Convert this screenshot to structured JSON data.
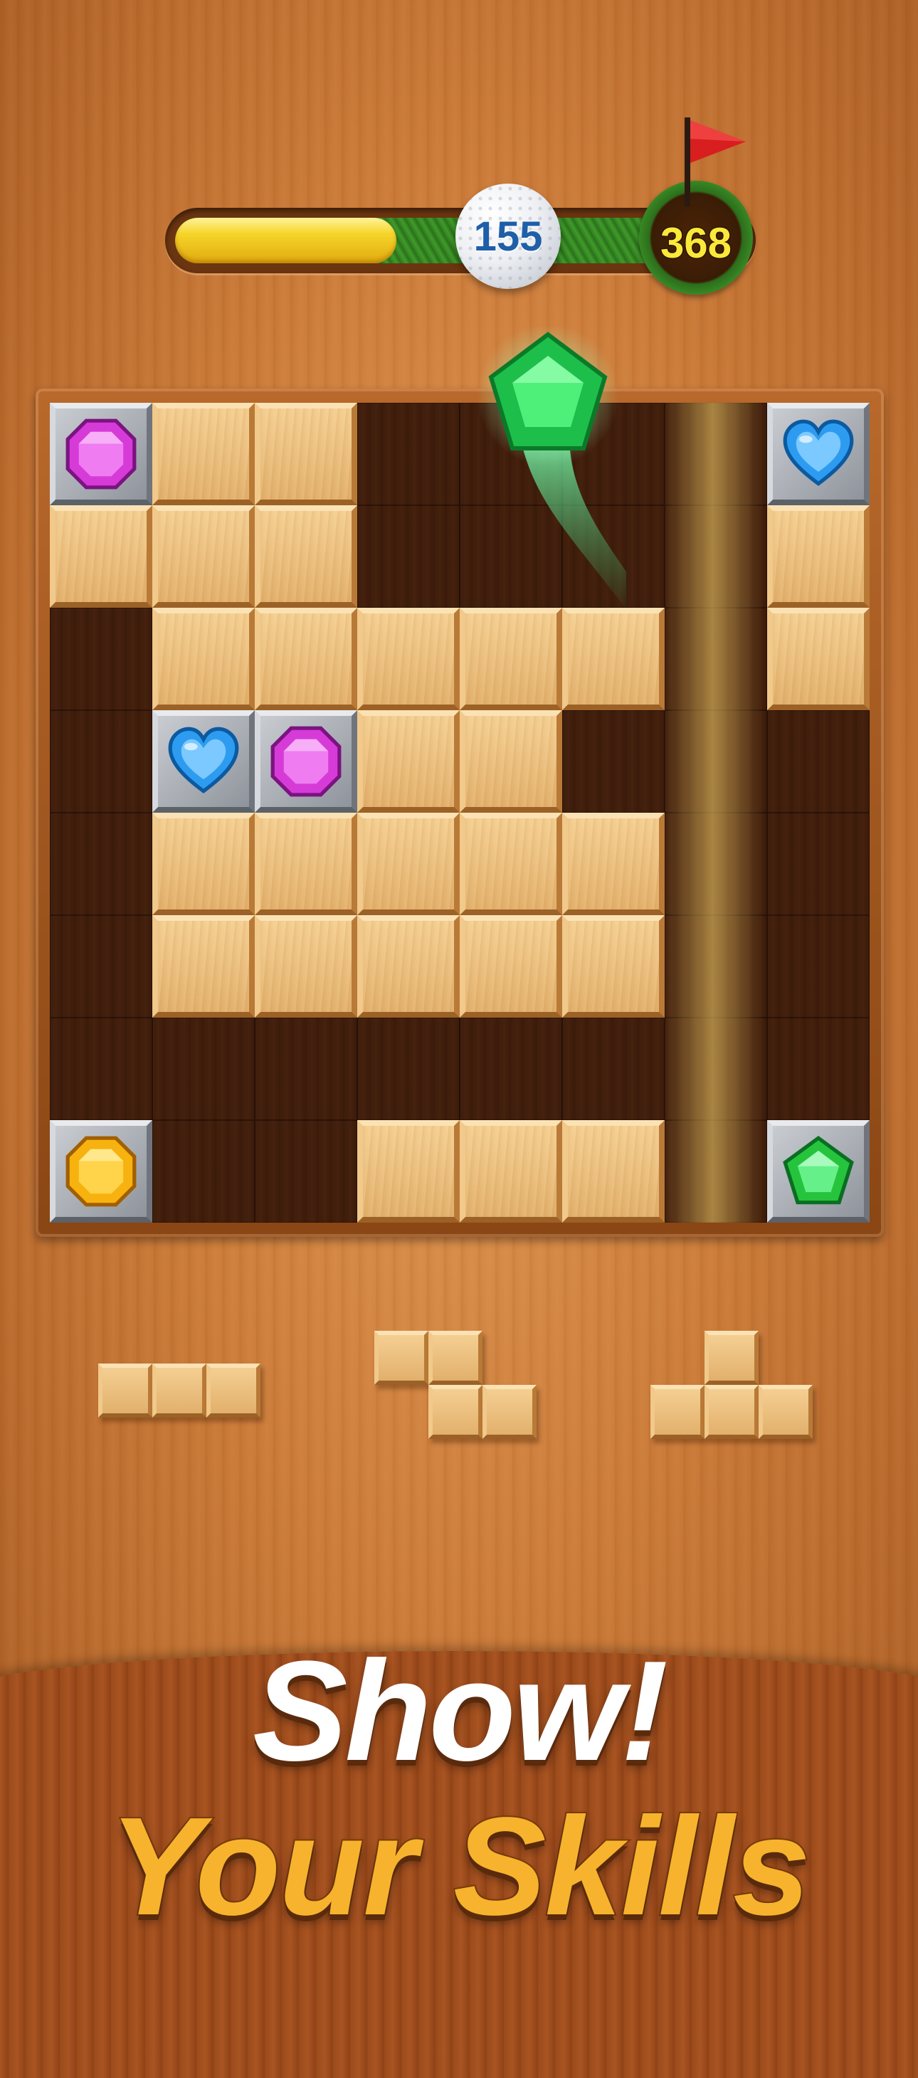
{
  "progress": {
    "current_score": "155",
    "target_score": "368",
    "fill_fraction": 0.44
  },
  "board": {
    "size": 8,
    "rows": [
      [
        "gem:purple-octagon",
        "wood",
        "wood",
        "empty",
        "empty",
        "empty",
        "empty",
        "gem:blue-heart"
      ],
      [
        "wood",
        "wood",
        "wood",
        "empty",
        "empty",
        "empty",
        "empty",
        "wood"
      ],
      [
        "empty",
        "wood",
        "wood",
        "wood",
        "wood",
        "wood",
        "empty",
        "wood"
      ],
      [
        "empty",
        "gem:blue-heart",
        "gem:purple-octagon",
        "wood",
        "wood",
        "empty",
        "empty",
        "empty"
      ],
      [
        "empty",
        "wood",
        "wood",
        "wood",
        "wood",
        "wood",
        "empty",
        "empty"
      ],
      [
        "empty",
        "wood",
        "wood",
        "wood",
        "wood",
        "wood",
        "empty",
        "empty"
      ],
      [
        "empty",
        "empty",
        "empty",
        "empty",
        "empty",
        "empty",
        "empty",
        "empty"
      ],
      [
        "gem:yellow-octagon",
        "empty",
        "empty",
        "wood",
        "wood",
        "wood",
        "empty",
        "gem:green-pentagon"
      ]
    ],
    "flying_gem": "green-pentagon-icon"
  },
  "tray": {
    "pieces": [
      {
        "name": "piece-line-3",
        "cells": [
          [
            0,
            0
          ],
          [
            0,
            1
          ],
          [
            0,
            2
          ]
        ]
      },
      {
        "name": "piece-z",
        "cells": [
          [
            0,
            0
          ],
          [
            0,
            1
          ],
          [
            1,
            1
          ],
          [
            1,
            2
          ]
        ]
      },
      {
        "name": "piece-t",
        "cells": [
          [
            0,
            1
          ],
          [
            1,
            0
          ],
          [
            1,
            1
          ],
          [
            1,
            2
          ]
        ]
      }
    ]
  },
  "banner": {
    "line1": "Show!",
    "line2": "Your Skills"
  },
  "colors": {
    "gem_purple": "#d63bd8",
    "gem_blue": "#2d9cf0",
    "gem_yellow": "#f7b20f",
    "gem_green": "#26c43d",
    "flag": "#d81e1e",
    "headline_white": "#ffffff",
    "headline_gold": "#f7b32d"
  }
}
